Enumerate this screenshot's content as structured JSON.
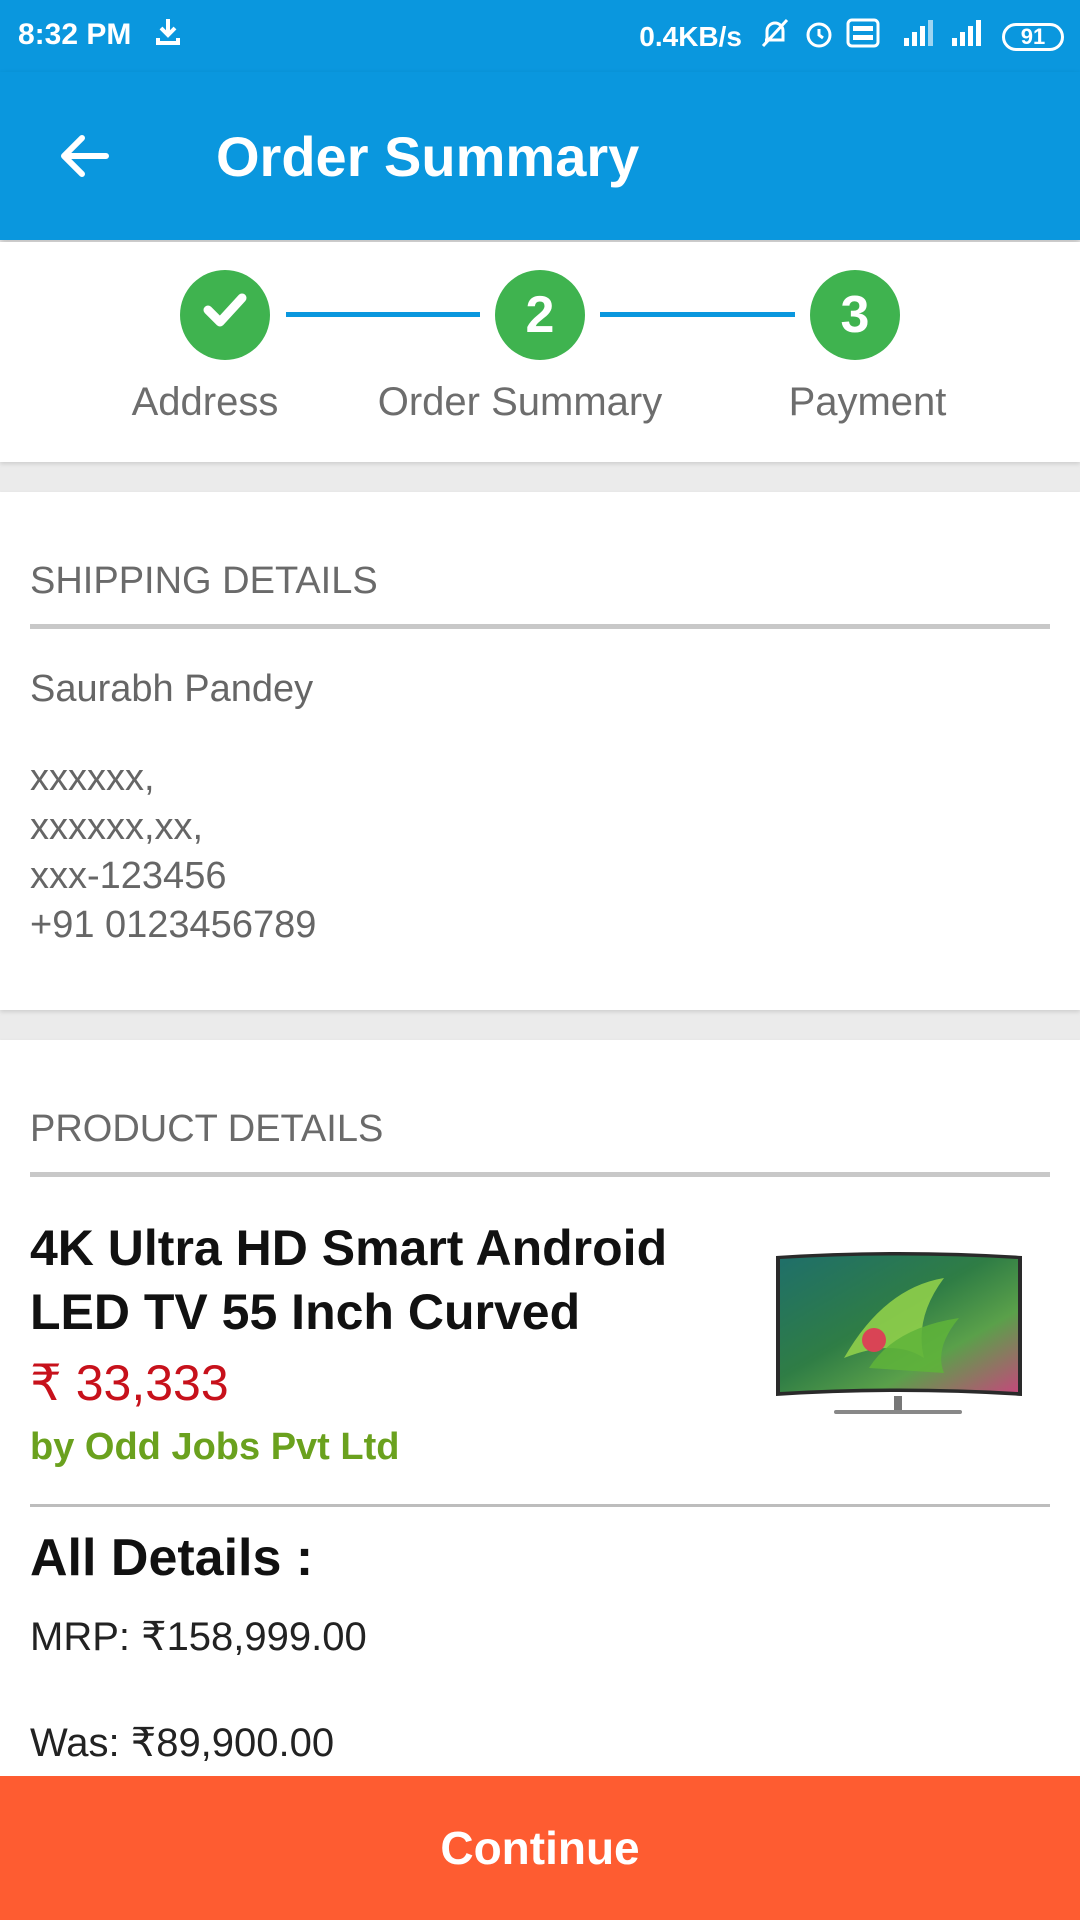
{
  "status_bar": {
    "time": "8:32 PM",
    "speed": "0.4KB/s",
    "battery": "91",
    "icons": [
      "download-icon",
      "mute-icon",
      "alarm-icon",
      "volte-icon",
      "signal-4g-icon",
      "signal-icon",
      "battery-icon"
    ]
  },
  "app_bar": {
    "title": "Order Summary",
    "back_icon": "arrow-left-icon"
  },
  "stepper": {
    "steps": [
      {
        "label": "Address",
        "marker": "✔",
        "state": "completed"
      },
      {
        "label": "Order Summary",
        "marker": "2",
        "state": "current"
      },
      {
        "label": "Payment",
        "marker": "3",
        "state": "pending"
      }
    ]
  },
  "shipping": {
    "title": "SHIPPING DETAILS",
    "name": "Saurabh Pandey",
    "address_lines": [
      "xxxxxx,",
      "xxxxxx,xx,",
      "xxx-123456",
      "+91 0123456789"
    ]
  },
  "product": {
    "section_title": "PRODUCT DETAILS",
    "name": "4K Ultra HD Smart Android LED TV 55 Inch Curved",
    "price": "₹ 33,333",
    "seller": "by Odd Jobs Pvt Ltd",
    "image_icon": "curved-tv-image",
    "details_title": "All Details :",
    "mrp": "MRP: ₹158,999.00",
    "was": "Was: ₹89,900.00"
  },
  "continue_button": {
    "label": "Continue"
  },
  "colors": {
    "primary": "#0a97de",
    "step_green": "#3fb34f",
    "price_red": "#c7111b",
    "seller_green": "#6aa11e",
    "cta_orange": "#fe5c31"
  }
}
